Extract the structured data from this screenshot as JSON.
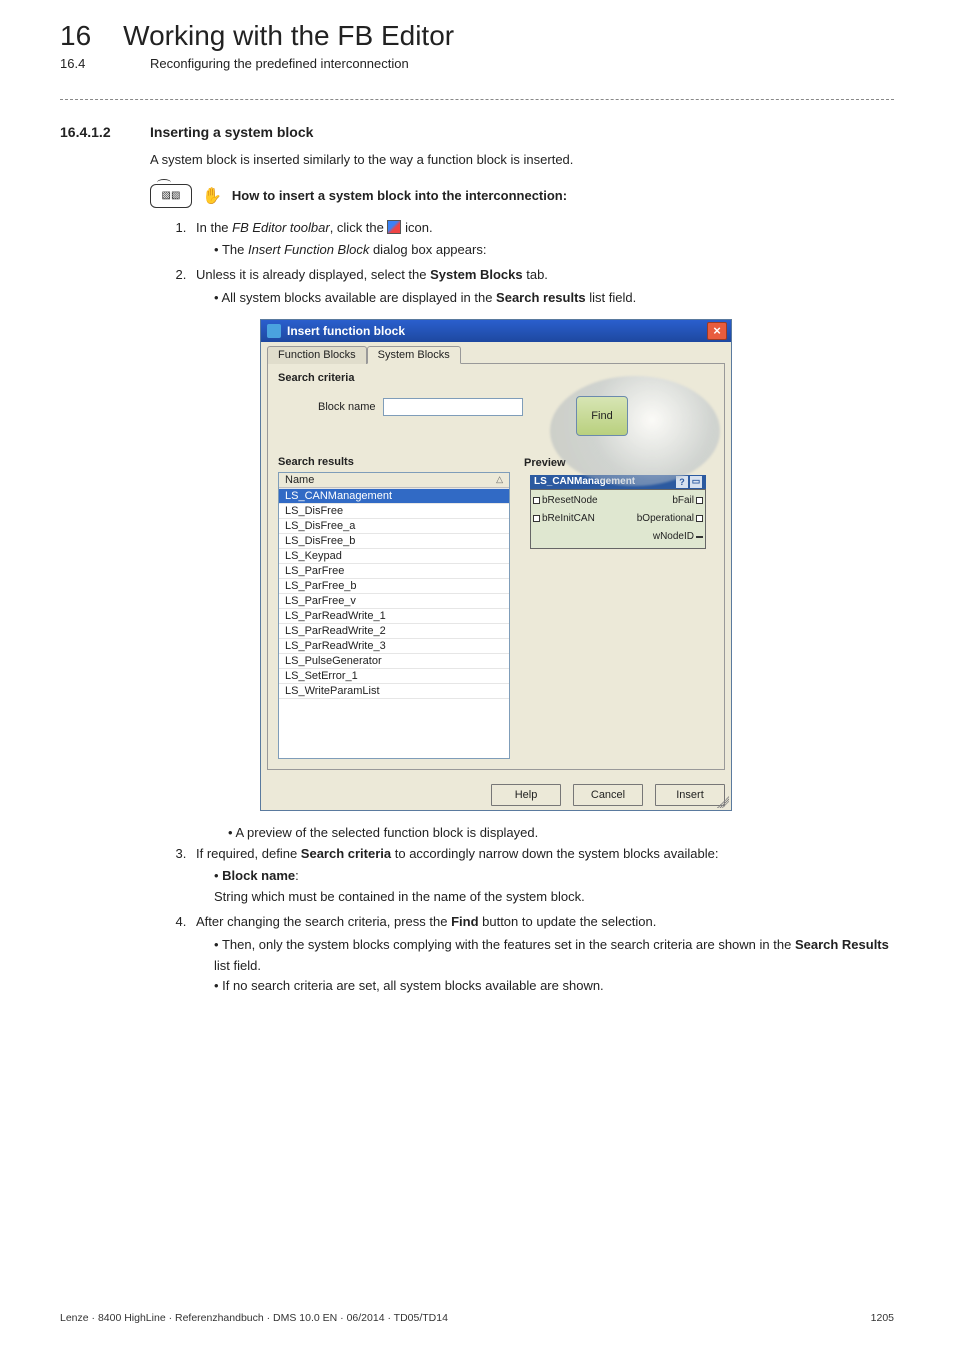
{
  "header": {
    "chapter_num": "16",
    "chapter_title": "Working with the FB Editor",
    "sub_num": "16.4",
    "sub_title": "Reconfiguring the predefined interconnection"
  },
  "section": {
    "num": "16.4.1.2",
    "title": "Inserting a system block"
  },
  "intro_paragraph": "A system block is inserted similarly to the way a function block is inserted.",
  "howto_label": "How to insert a system block into the interconnection:",
  "steps": {
    "s1_pre": "In the ",
    "s1_toolbar": "FB Editor toolbar",
    "s1_mid": ", click the ",
    "s1_post": " icon.",
    "s1_b1_pre": "The ",
    "s1_b1_dialog": "Insert Function Block",
    "s1_b1_post": " dialog box appears:",
    "s2_pre": "Unless it is already displayed, select the ",
    "s2_tab": "System Blocks",
    "s2_post": " tab.",
    "s2_b1_pre": "All system blocks available are displayed in the ",
    "s2_b1_field": "Search results",
    "s2_b1_post": " list field.",
    "after_dialog_bullet": "A preview of the selected function block is displayed.",
    "s3_pre": "If required, define ",
    "s3_term": "Search criteria",
    "s3_post": " to accordingly narrow down the system blocks available:",
    "s3_b1_label": "Block name",
    "s3_b1_colon": ":",
    "s3_b1_desc": "String which must be contained in the name of the system block.",
    "s4_pre": "After changing the search criteria, press the ",
    "s4_btn": "Find",
    "s4_post": " button to update the selection.",
    "s4_b1_pre": "Then, only the system blocks complying with the features set in the search criteria are shown in the ",
    "s4_b1_field": "Search Results",
    "s4_b1_post": " list field.",
    "s4_b2": "If no search criteria are set, all system blocks available are shown."
  },
  "dialog": {
    "title": "Insert function block",
    "tab_fb": "Function Blocks",
    "tab_sb": "System Blocks",
    "criteria_group": "Search criteria",
    "block_name_label": "Block name",
    "block_name_value": "",
    "find_label": "Find",
    "results_group": "Search results",
    "preview_group": "Preview",
    "col_name": "Name",
    "rows": {
      "r0": "LS_CANManagement",
      "r1": "LS_DisFree",
      "r2": "LS_DisFree_a",
      "r3": "LS_DisFree_b",
      "r4": "LS_Keypad",
      "r5": "LS_ParFree",
      "r6": "LS_ParFree_b",
      "r7": "LS_ParFree_v",
      "r8": "LS_ParReadWrite_1",
      "r9": "LS_ParReadWrite_2",
      "r10": "LS_ParReadWrite_3",
      "r11": "LS_PulseGenerator",
      "r12": "LS_SetError_1",
      "r13": "LS_WriteParamList"
    },
    "preview_block": {
      "title": "LS_CANManagement",
      "in1": "bResetNode",
      "out1": "bFail",
      "in2": "bReInitCAN",
      "out2": "bOperational",
      "out3": "wNodeID"
    },
    "btn_help": "Help",
    "btn_cancel": "Cancel",
    "btn_insert": "Insert"
  },
  "footer": {
    "left": "Lenze · 8400 HighLine · Referenzhandbuch · DMS 10.0 EN · 06/2014 · TD05/TD14",
    "right": "1205"
  }
}
